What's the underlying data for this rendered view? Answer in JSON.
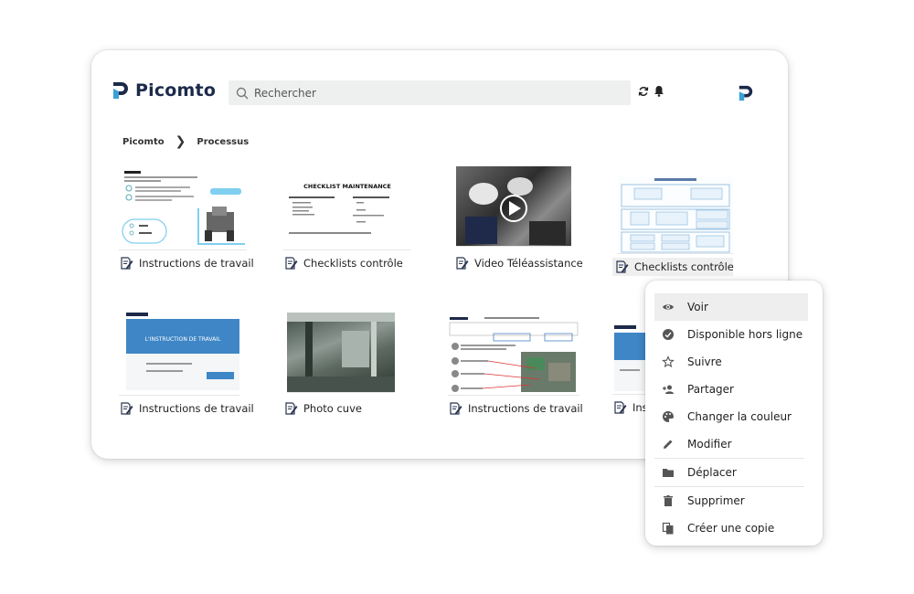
{
  "app": {
    "name": "Picomto",
    "brand_color": "#1c2a4a",
    "accent_color": "#3aa0d8"
  },
  "search": {
    "placeholder": "Rechercher"
  },
  "breadcrumb": {
    "items": [
      "Picomto",
      "Processus"
    ]
  },
  "tiles": [
    {
      "label": "Instructions de travail",
      "thumb": "instruction-steps",
      "icon": "document-edit-icon"
    },
    {
      "label": "Checklists contrôle",
      "thumb": "checklist-maintenance",
      "thumb_title": "CHECKLIST MAINTENANCE",
      "icon": "document-edit-icon"
    },
    {
      "label": "Video Téléassistance",
      "thumb": "video",
      "icon": "document-edit-icon"
    },
    {
      "label": "Checklists contrôle",
      "thumb": "process-map",
      "icon": "document-edit-icon"
    },
    {
      "label": "Instructions de travail",
      "thumb": "instruction-screen",
      "thumb_title": "L'INSTRUCTION DE TRAVAIL",
      "icon": "document-edit-icon"
    },
    {
      "label": "Photo cuve",
      "thumb": "photo",
      "icon": "document-edit-icon"
    },
    {
      "label": "Instructions de travail",
      "thumb": "instruction-diagram",
      "icon": "document-edit-icon"
    },
    {
      "label": "Ins",
      "thumb": "instruction-screen",
      "icon": "document-edit-icon"
    }
  ],
  "context_menu": {
    "items": [
      {
        "label": "Voir",
        "icon": "eye-icon"
      },
      {
        "label": "Disponible hors ligne",
        "icon": "offline-check-icon"
      },
      {
        "label": "Suivre",
        "icon": "star-icon"
      },
      {
        "label": "Partager",
        "icon": "person-add-icon"
      },
      {
        "label": "Changer la couleur",
        "icon": "palette-icon"
      },
      {
        "label": "Modifier",
        "icon": "pencil-icon"
      },
      {
        "label": "Déplacer",
        "icon": "folder-icon"
      },
      {
        "label": "Supprimer",
        "icon": "trash-icon"
      },
      {
        "label": "Créer une copie",
        "icon": "copy-icon"
      }
    ]
  }
}
